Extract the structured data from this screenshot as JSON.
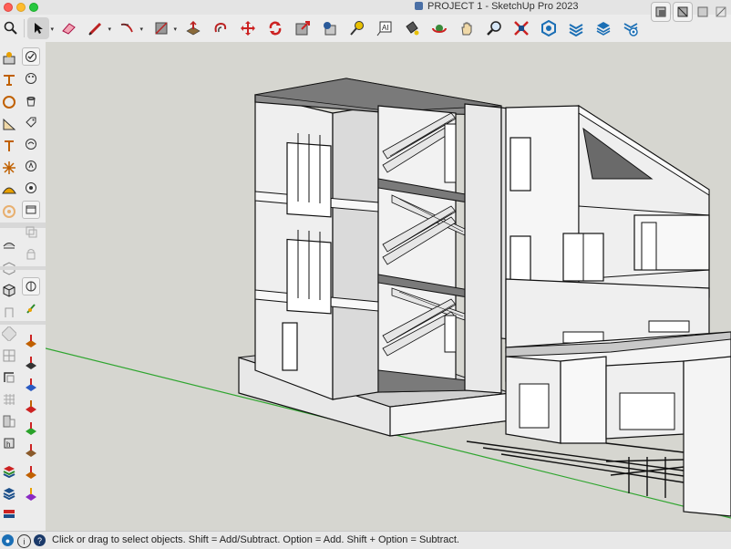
{
  "window": {
    "title": "PROJECT 1 - SketchUp Pro 2023"
  },
  "toolbar": {
    "tools": [
      {
        "name": "search-icon",
        "glyph": "🔍"
      },
      {
        "name": "select-tool-icon",
        "glyph": "➤"
      },
      {
        "name": "eraser-tool-icon",
        "glyph": "▰"
      },
      {
        "name": "pencil-line-tool-icon",
        "glyph": "✎"
      },
      {
        "name": "arc-tool-icon",
        "glyph": "⌒"
      },
      {
        "name": "rectangle-tool-icon",
        "glyph": "▨"
      },
      {
        "name": "push-pull-tool-icon",
        "glyph": "⬘"
      },
      {
        "name": "offset-tool-icon",
        "glyph": "↺"
      },
      {
        "name": "move-tool-icon",
        "glyph": "✥"
      },
      {
        "name": "rotate-tool-icon",
        "glyph": "⟳"
      },
      {
        "name": "scale-tool-icon",
        "glyph": "⇱"
      },
      {
        "name": "follow-me-tool-icon",
        "glyph": "⬢"
      },
      {
        "name": "tape-measure-tool-icon",
        "glyph": "✐"
      },
      {
        "name": "text-tool-icon",
        "glyph": "A"
      },
      {
        "name": "paint-bucket-tool-icon",
        "glyph": "◍"
      },
      {
        "name": "orbit-tool-icon",
        "glyph": "◉"
      },
      {
        "name": "pan-tool-icon",
        "glyph": "✋"
      },
      {
        "name": "zoom-tool-icon",
        "glyph": "⌕"
      },
      {
        "name": "zoom-extents-tool-icon",
        "glyph": "✕"
      },
      {
        "name": "warehouse-icon",
        "glyph": "⬡"
      },
      {
        "name": "extension-warehouse-icon",
        "glyph": "≋"
      },
      {
        "name": "layout-icon",
        "glyph": "≣"
      },
      {
        "name": "extension-manager-icon",
        "glyph": "⚙"
      }
    ]
  },
  "status": {
    "message": "Click or drag to select objects. Shift = Add/Subtract. Option = Add. Shift + Option = Subtract."
  },
  "colors": {
    "viewport_bg": "#d6d6d0",
    "green_axis": "#2fa52f",
    "close": "#ff5f57",
    "minimize": "#febc2e",
    "maximize": "#28c840"
  }
}
